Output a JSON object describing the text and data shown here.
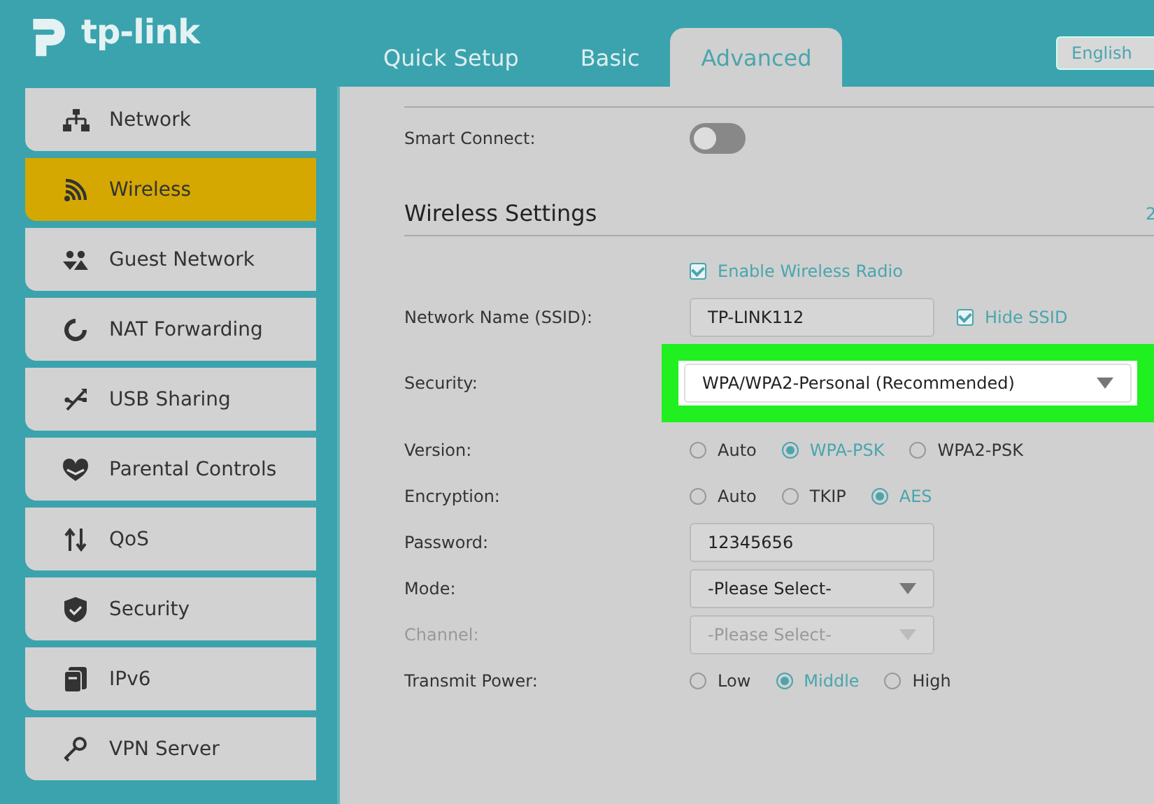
{
  "header": {
    "logo": "tp-link",
    "tabs": [
      {
        "label": "Quick Setup",
        "selected": false
      },
      {
        "label": "Basic",
        "selected": false
      },
      {
        "label": "Advanced",
        "selected": true
      }
    ],
    "language": "English"
  },
  "sidebar": {
    "items": [
      {
        "label": "Network",
        "selected": false
      },
      {
        "label": "Wireless",
        "selected": true
      },
      {
        "label": "Guest Network",
        "selected": false
      },
      {
        "label": "NAT Forwarding",
        "selected": false
      },
      {
        "label": "USB Sharing",
        "selected": false
      },
      {
        "label": "Parental Controls",
        "selected": false
      },
      {
        "label": "QoS",
        "selected": false
      },
      {
        "label": "Security",
        "selected": false
      },
      {
        "label": "IPv6",
        "selected": false
      },
      {
        "label": "VPN Server",
        "selected": false
      }
    ]
  },
  "content": {
    "smart_connect": {
      "label": "Smart Connect:",
      "on": false
    },
    "section": {
      "title": "Wireless Settings",
      "side_text": "2"
    },
    "enable_radio": {
      "label": "Enable Wireless Radio",
      "checked": true
    },
    "fields": [
      {
        "kind": "text",
        "label": "Network Name (SSID):",
        "value": "TP-LINK112",
        "disabled": false,
        "highlighted": false,
        "extra": {
          "label": "Hide SSID",
          "checked": true
        }
      },
      {
        "kind": "select",
        "label": "Security:",
        "value": "WPA/WPA2-Personal (Recommended)",
        "disabled": false,
        "highlighted": true
      },
      {
        "kind": "radio",
        "label": "Version:",
        "disabled": false,
        "highlighted": false,
        "options": [
          {
            "label": "Auto",
            "selected": false
          },
          {
            "label": "WPA-PSK",
            "selected": true
          },
          {
            "label": "WPA2-PSK",
            "selected": false
          }
        ]
      },
      {
        "kind": "radio",
        "label": "Encryption:",
        "disabled": false,
        "highlighted": false,
        "options": [
          {
            "label": "Auto",
            "selected": false
          },
          {
            "label": "TKIP",
            "selected": false
          },
          {
            "label": "AES",
            "selected": true
          }
        ]
      },
      {
        "kind": "text",
        "label": "Password:",
        "value": "12345656",
        "disabled": false,
        "highlighted": false
      },
      {
        "kind": "select",
        "label": "Mode:",
        "value": "-Please Select-",
        "disabled": false,
        "highlighted": false
      },
      {
        "kind": "select",
        "label": "Channel:",
        "value": "-Please Select-",
        "disabled": true,
        "highlighted": false
      },
      {
        "kind": "radio",
        "label": "Transmit Power:",
        "disabled": false,
        "highlighted": false,
        "options": [
          {
            "label": "Low",
            "selected": false
          },
          {
            "label": "Middle",
            "selected": true
          },
          {
            "label": "High",
            "selected": false
          }
        ]
      }
    ]
  }
}
